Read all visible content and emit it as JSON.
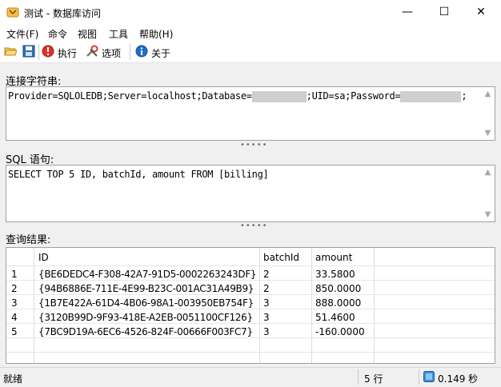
{
  "window": {
    "title": "测试 - 数据库访问",
    "minimize_glyph": "—",
    "maximize_glyph": "☐",
    "close_glyph": "✕"
  },
  "menu": [
    "文件(F)",
    "命令",
    "视图",
    "工具",
    "帮助(H)"
  ],
  "toolbar": {
    "execute_label": "执行",
    "options_label": "选项",
    "about_label": "关于",
    "icons": [
      "open-folder-icon",
      "save-icon",
      "execute-icon",
      "options-icon",
      "about-icon"
    ]
  },
  "connection": {
    "label": "连接字符串:",
    "prefix": "Provider=SQLOLEDB;Server=localhost;Database=",
    "middle": ";UID=sa;Password=",
    "suffix": ";"
  },
  "sql": {
    "label": "SQL 语句:",
    "text": "SELECT TOP 5 ID, batchId, amount FROM [billing]"
  },
  "results": {
    "label": "查询结果:",
    "columns": [
      "ID",
      "batchId",
      "amount"
    ],
    "rows": [
      [
        "1",
        "{BE6DEDC4-F308-42A7-91D5-0002263243DF}",
        "2",
        "33.5800"
      ],
      [
        "2",
        "{94B6886E-711E-4E99-B23C-001AC31A49B9}",
        "2",
        "850.0000"
      ],
      [
        "3",
        "{1B7E422A-61D4-4B06-98A1-003950EB754F}",
        "3",
        "888.0000"
      ],
      [
        "4",
        "{3120B99D-9F93-418E-A2EB-0051100CF126}",
        "3",
        "51.4600"
      ],
      [
        "5",
        "{7BC9D19A-6EC6-4526-824F-00666F003FC7}",
        "3",
        "-160.0000"
      ]
    ]
  },
  "status": {
    "ready": "就绪",
    "row_count": "5 行",
    "elapsed": "0.149 秒"
  },
  "colors": {
    "accent_blue": "#1e6fc8",
    "execute_red": "#d9342b",
    "folder_yellow": "#e8b640"
  }
}
